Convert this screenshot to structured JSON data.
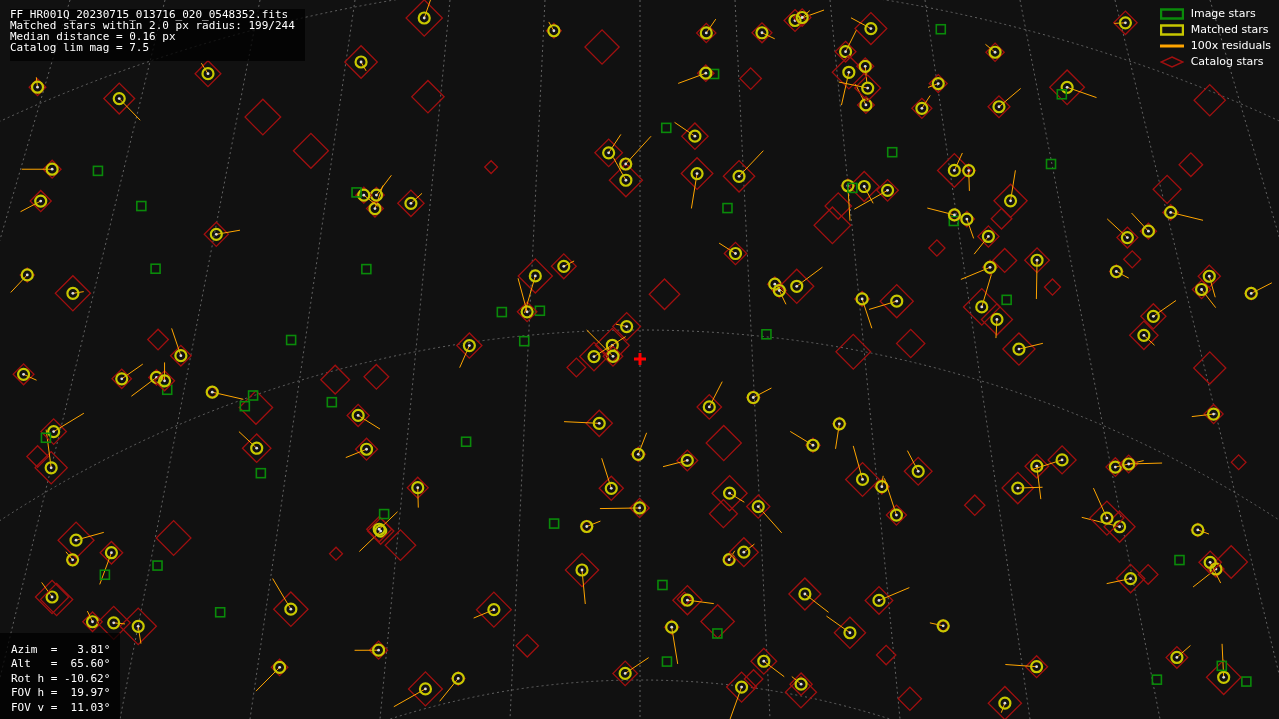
{
  "header": {
    "lines": [
      "FF_HR001Q_20230715_013716_020_0548352.fits",
      "Matched stars within 2.0 px radius: 199/244",
      "Median distance = 0.16 px",
      "Catalog lim mag = 7.5"
    ]
  },
  "legend": [
    {
      "kind": "square",
      "label": "Image stars",
      "color": "#0a8a0a"
    },
    {
      "kind": "circle",
      "label": "Matched stars",
      "color": "#c8c800"
    },
    {
      "kind": "line",
      "label": "100x residuals",
      "color": "#ffa500"
    },
    {
      "kind": "diamond",
      "label": "Catalog stars",
      "color": "#a01010"
    }
  ],
  "pointing": {
    "lines": [
      "Azim  =   3.81°",
      "Alt   =  65.60°",
      "Rot h = -10.62°",
      "FOV h =  19.97°",
      "FOV v =  11.03°"
    ]
  }
}
